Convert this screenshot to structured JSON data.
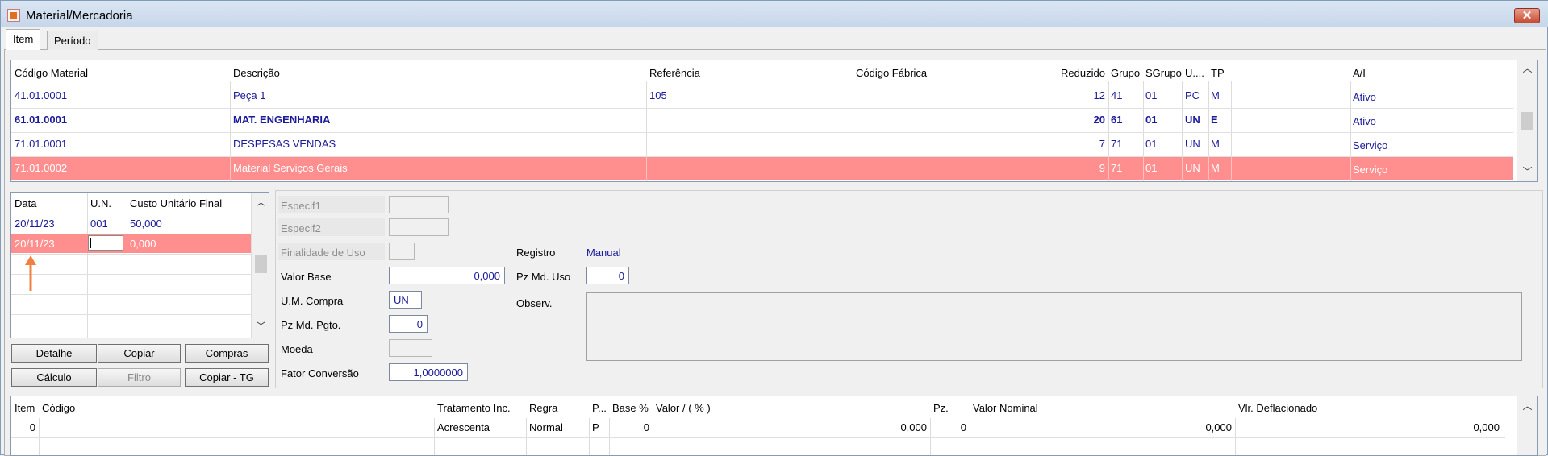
{
  "window": {
    "title": "Material/Mercadoria",
    "close_label": "✕",
    "app_icon": "app-icon"
  },
  "tabs": [
    {
      "label": "Item",
      "active": true
    },
    {
      "label": "Período",
      "active": false
    }
  ],
  "materials_grid": {
    "headers": [
      "Código Material",
      "Descrição",
      "Referência",
      "Código Fábrica",
      "Reduzido",
      "Grupo",
      "SGrupo",
      "U....",
      "TP",
      "A/I"
    ],
    "rows": [
      {
        "codigo": "41.01.0001",
        "descricao": "Peça 1",
        "referencia": "105",
        "fabrica": "",
        "reduzido": "12",
        "grupo": "41",
        "sgrupo": "01",
        "un": "PC",
        "tp": "M",
        "ai": "Ativo",
        "style": "normal"
      },
      {
        "codigo": "61.01.0001",
        "descricao": "MAT. ENGENHARIA",
        "referencia": "",
        "fabrica": "",
        "reduzido": "20",
        "grupo": "61",
        "sgrupo": "01",
        "un": "UN",
        "tp": "E",
        "ai": "Ativo",
        "style": "bold"
      },
      {
        "codigo": "71.01.0001",
        "descricao": "DESPESAS VENDAS",
        "referencia": "",
        "fabrica": "",
        "reduzido": "7",
        "grupo": "71",
        "sgrupo": "01",
        "un": "UN",
        "tp": "M",
        "ai": "Serviço",
        "style": "normal"
      },
      {
        "codigo": "71.01.0002",
        "descricao": "Material Serviços Gerais",
        "referencia": "",
        "fabrica": "",
        "reduzido": "9",
        "grupo": "71",
        "sgrupo": "01",
        "un": "UN",
        "tp": "M",
        "ai": "Serviço",
        "style": "selected"
      }
    ]
  },
  "cost_grid": {
    "headers": [
      "Data",
      "U.N.",
      "Custo Unitário Final"
    ],
    "rows": [
      {
        "data": "20/11/23",
        "un": "001",
        "custo": "50,000",
        "style": "normal"
      },
      {
        "data": "20/11/23",
        "un": "",
        "custo": "0,000",
        "style": "selected"
      }
    ]
  },
  "buttons": {
    "detalhe": "Detalhe",
    "copiar": "Copiar",
    "compras": "Compras",
    "calculo": "Cálculo",
    "filtro": "Filtro",
    "copiar_tg": "Copiar - TG"
  },
  "form": {
    "especif1_label": "Especif1",
    "especif2_label": "Especif2",
    "finalidade_label": "Finalidade de Uso",
    "valor_base_label": "Valor Base",
    "valor_base_value": "0,000",
    "um_compra_label": "U.M. Compra",
    "um_compra_value": "UN",
    "pz_md_pgto_label": "Pz Md. Pgto.",
    "pz_md_pgto_value": "0",
    "moeda_label": "Moeda",
    "fator_label": "Fator Conversão",
    "fator_value": "1,0000000",
    "registro_label": "Registro",
    "registro_value": "Manual",
    "pz_md_uso_label": "Pz Md. Uso",
    "pz_md_uso_value": "0",
    "observ_label": "Observ."
  },
  "bottom_grid": {
    "headers": [
      "Item",
      "Código",
      "Tratamento Inc.",
      "Regra",
      "P...",
      "Base %",
      "Valor / ( % )",
      "Pz.",
      "Valor Nominal",
      "Vlr. Deflacionado"
    ],
    "row": {
      "item": "0",
      "codigo": "",
      "tratamento": "Acrescenta",
      "regra": "Normal",
      "p": "P",
      "base": "0",
      "valor": "0,000",
      "pz": "0",
      "nominal": "0,000",
      "deflacionado": "0,000"
    }
  },
  "colors": {
    "selection": "#ff8f8f",
    "value_text": "#1a1a9a",
    "annotation_arrow": "#f08040"
  }
}
